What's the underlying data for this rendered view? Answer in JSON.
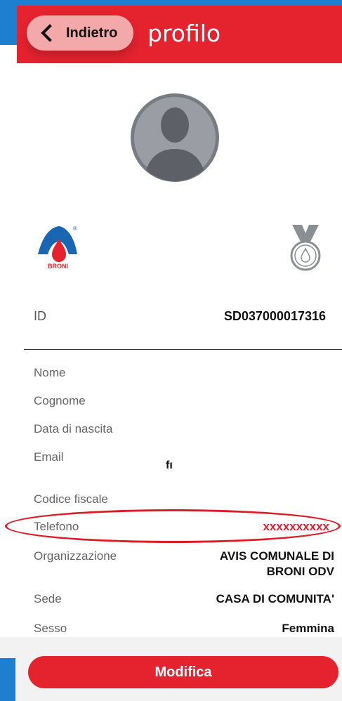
{
  "header": {
    "back_label": "Indietro",
    "title": "profilo"
  },
  "logos": {
    "avis_text": "BRONI",
    "avis_mark": "®"
  },
  "profile": {
    "id_label": "ID",
    "id_value": "SD037000017316",
    "fields": [
      {
        "label": "Nome",
        "value": ""
      },
      {
        "label": "Cognome",
        "value": ""
      },
      {
        "label": "Data di nascita",
        "value": ""
      },
      {
        "label": "Email",
        "value": "fı"
      },
      {
        "label": "Codice fiscale",
        "value": ""
      },
      {
        "label": "Telefono",
        "value": "xxxxxxxxxx"
      },
      {
        "label": "Organizzazione",
        "value_line1": "AVIS COMUNALE DI",
        "value_line2": "BRONI ODV"
      },
      {
        "label": "Sede",
        "value": "CASA DI COMUNITA'"
      },
      {
        "label": "Sesso",
        "value": "Femmina"
      }
    ]
  },
  "footer": {
    "edit_label": "Modifica"
  },
  "colors": {
    "accent": "#e5232f",
    "blue": "#1e7fd0",
    "phone": "#e0222e"
  }
}
